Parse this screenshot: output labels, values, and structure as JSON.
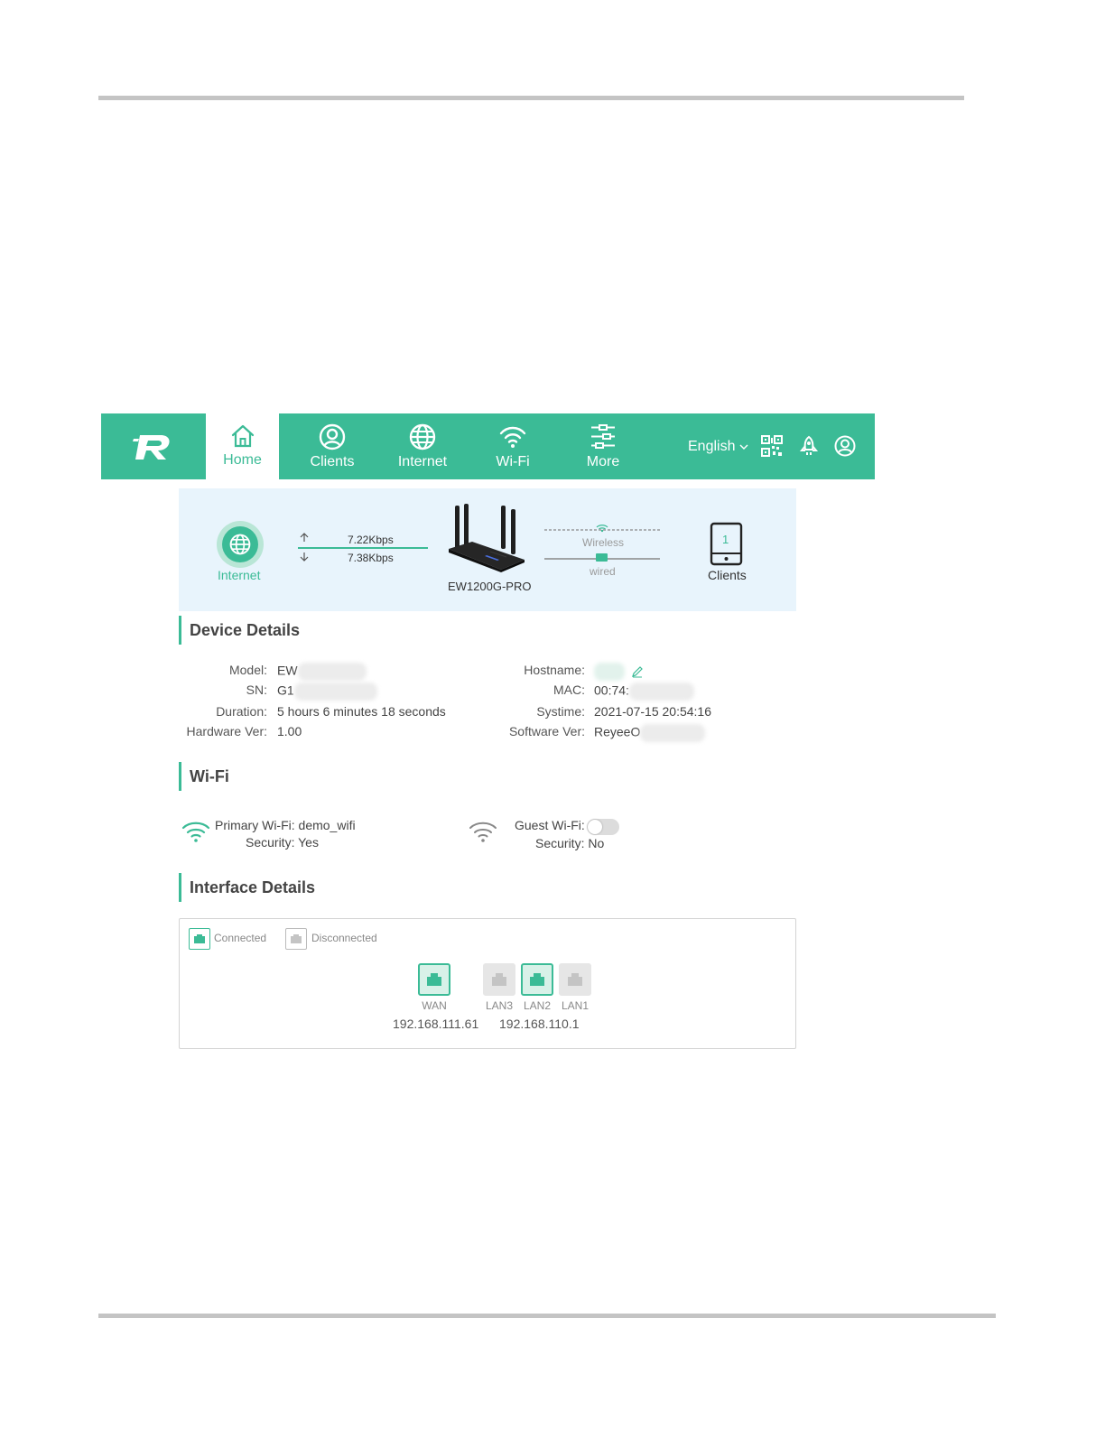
{
  "nav": {
    "tabs": [
      {
        "label": "Home",
        "icon": "home-icon"
      },
      {
        "label": "Clients",
        "icon": "user-icon"
      },
      {
        "label": "Internet",
        "icon": "globe-icon"
      },
      {
        "label": "Wi-Fi",
        "icon": "wifi-icon"
      },
      {
        "label": "More",
        "icon": "more-icon"
      }
    ],
    "language": "English",
    "header_icons": [
      "qr-code-icon",
      "rocket-icon",
      "account-icon"
    ]
  },
  "topology": {
    "internet_label": "Internet",
    "upload_rate": "7.22Kbps",
    "download_rate": "7.38Kbps",
    "device_name": "EW1200G-PRO",
    "wireless_label": "Wireless",
    "wired_label": "wired",
    "client_count": "1",
    "clients_label": "Clients"
  },
  "device_details": {
    "title": "Device Details",
    "model_label": "Model:",
    "model_value": "EW",
    "sn_label": "SN:",
    "sn_value": "G1",
    "duration_label": "Duration:",
    "duration_value": "5 hours 6 minutes 18 seconds",
    "hardware_label": "Hardware Ver:",
    "hardware_value": "1.00",
    "hostname_label": "Hostname:",
    "mac_label": "MAC:",
    "mac_value": "00:74:",
    "systime_label": "Systime:",
    "systime_value": "2021-07-15 20:54:16",
    "software_label": "Software Ver:",
    "software_value": "ReyeeO"
  },
  "wifi": {
    "title": "Wi-Fi",
    "primary": "Primary Wi-Fi: demo_wifi",
    "primary_security": "Security: Yes",
    "guest_label": "Guest Wi-Fi:",
    "guest_enabled": false,
    "guest_security": "Security: No"
  },
  "interface": {
    "title": "Interface Details",
    "legend_connected": "Connected",
    "legend_disconnected": "Disconnected",
    "ports": [
      {
        "name": "WAN",
        "status": "connected"
      },
      {
        "name": "LAN3",
        "status": "disconnected"
      },
      {
        "name": "LAN2",
        "status": "connected"
      },
      {
        "name": "LAN1",
        "status": "disconnected"
      }
    ],
    "wan_ip": "192.168.111.61",
    "lan_ip": "192.168.110.1"
  },
  "colors": {
    "accent": "#3bbb96",
    "panel": "#e8f4fc"
  }
}
